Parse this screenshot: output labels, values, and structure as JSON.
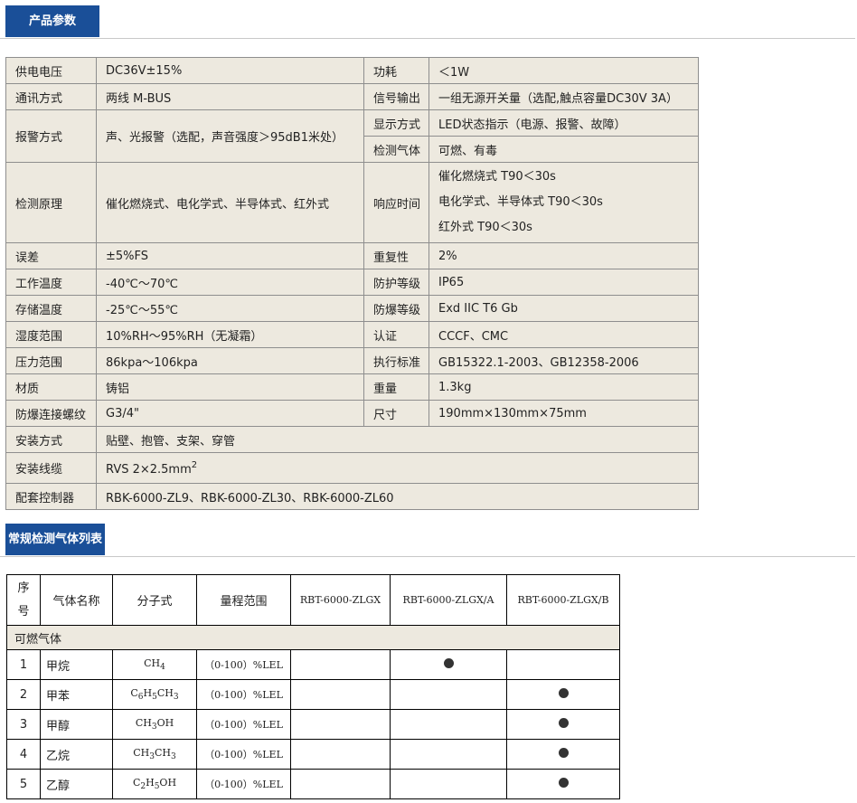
{
  "sections": {
    "params_title": "产品参数",
    "gas_list_title": "常规检测气体列表"
  },
  "spec": {
    "supply_voltage_label": "供电电压",
    "supply_voltage_value": "DC36V±15%",
    "power_label": "功耗",
    "power_value": "＜1W",
    "comm_label": "通讯方式",
    "comm_value": "两线 M-BUS",
    "signal_out_label": "信号输出",
    "signal_out_value": "一组无源开关量（选配,触点容量DC30V 3A）",
    "alarm_label": "报警方式",
    "alarm_value": "声、光报警（选配，声音强度＞95dB1米处）",
    "display_label": "显示方式",
    "display_value": "LED状态指示（电源、报警、故障）",
    "gas_label": "检测气体",
    "gas_value": "可燃、有毒",
    "principle_label": "检测原理",
    "principle_value": "催化燃烧式、电化学式、半导体式、红外式",
    "response_label": "响应时间",
    "response_line1": "催化燃烧式 T90＜30s",
    "response_line2": "电化学式、半导体式 T90＜30s",
    "response_line3": "红外式 T90＜30s",
    "error_label": "误差",
    "error_value": "±5%FS",
    "repeat_label": "重复性",
    "repeat_value": "2%",
    "work_temp_label": "工作温度",
    "work_temp_value": "-40℃～70℃",
    "protect_label": "防护等级",
    "protect_value": "IP65",
    "store_temp_label": "存储温度",
    "store_temp_value": "-25℃～55℃",
    "ex_label": "防爆等级",
    "ex_value": "Exd IIC T6 Gb",
    "humidity_label": "湿度范围",
    "humidity_value": "10%RH～95%RH（无凝霜）",
    "cert_label": "认证",
    "cert_value": "CCCF、CMC",
    "pressure_label": "压力范围",
    "pressure_value": "86kpa～106kpa",
    "standard_label": "执行标准",
    "standard_value": "GB15322.1-2003、GB12358-2006",
    "material_label": "材质",
    "material_value": "铸铝",
    "weight_label": "重量",
    "weight_value": "1.3kg",
    "thread_label": "防爆连接螺纹",
    "thread_value": "G3/4\"",
    "size_label": "尺寸",
    "size_value": "190mm×130mm×75mm",
    "install_label": "安装方式",
    "install_value": "贴壁、抱管、支架、穿管",
    "cable_label": "安装线缆",
    "cable_value": "RVS 2×2.5mm",
    "cable_sup": "2",
    "controller_label": "配套控制器",
    "controller_value": "RBK-6000-ZL9、RBK-6000-ZL30、RBK-6000-ZL60"
  },
  "gas_table": {
    "headers": {
      "no_line1": "序",
      "no_line2": "号",
      "name": "气体名称",
      "formula": "分子式",
      "range": "量程范围",
      "model1": "RBT-6000-ZLGX",
      "model2": "RBT-6000-ZLGX/A",
      "model3": "RBT-6000-ZLGX/B"
    },
    "category": "可燃气体",
    "rows": [
      {
        "no": "1",
        "name": "甲烷",
        "formula": "CH4",
        "range": "（0-100）%LEL",
        "model": 1
      },
      {
        "no": "2",
        "name": "甲苯",
        "formula": "C6H5CH3",
        "range": "（0-100）%LEL",
        "model": 2
      },
      {
        "no": "3",
        "name": "甲醇",
        "formula": "CH3OH",
        "range": "（0-100）%LEL",
        "model": 2
      },
      {
        "no": "4",
        "name": "乙烷",
        "formula": "CH3CH3",
        "range": "（0-100）%LEL",
        "model": 2
      },
      {
        "no": "5",
        "name": "乙醇",
        "formula": "C2H5OH",
        "range": "（0-100）%LEL",
        "model": 2
      }
    ]
  }
}
